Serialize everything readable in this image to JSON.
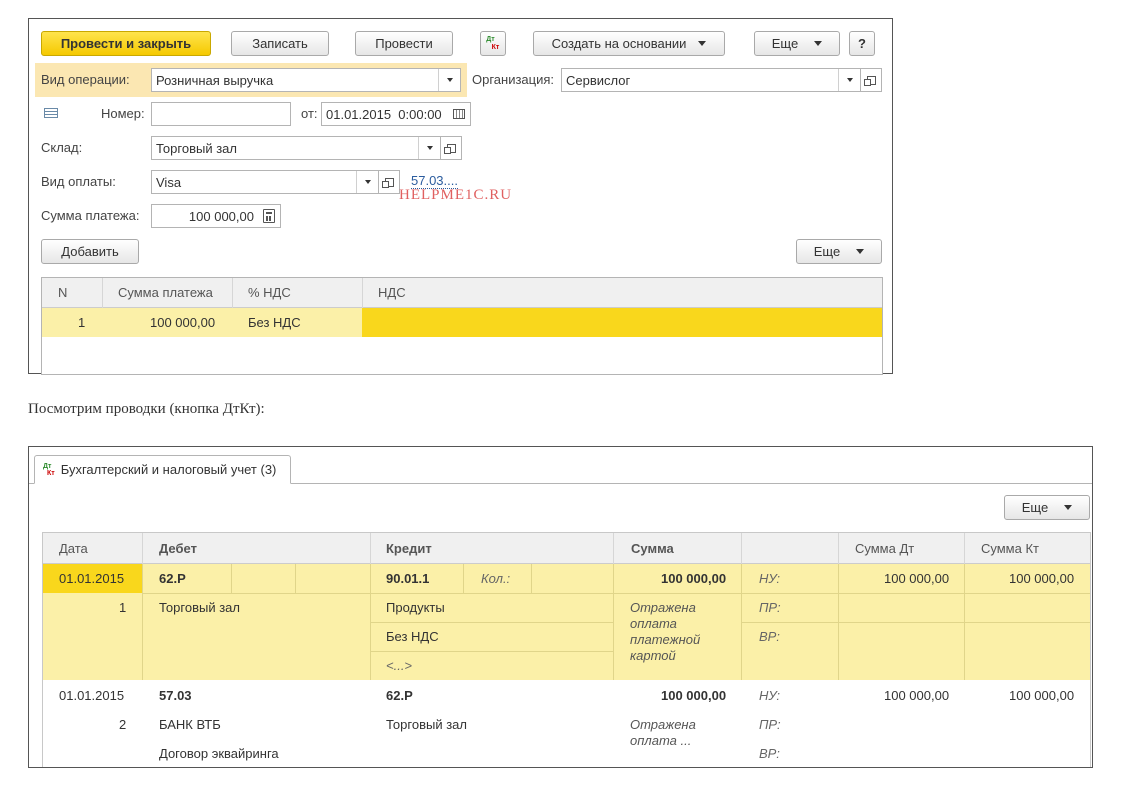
{
  "doc": {
    "toolbar": {
      "post_close": "Провести и закрыть",
      "save": "Записать",
      "post": "Провести",
      "dtkt_top": "Дт",
      "dtkt_bottom": "Кт",
      "create_basis": "Создать на основании",
      "more": "Еще",
      "help": "?"
    },
    "op_type": {
      "label": "Вид операции:",
      "value": "Розничная выручка"
    },
    "org": {
      "label": "Организация:",
      "value": "Сервислог"
    },
    "number": {
      "label": "Номер:",
      "value": ""
    },
    "date": {
      "label": "от:",
      "value": "01.01.2015  0:00:00"
    },
    "warehouse": {
      "label": "Склад:",
      "value": "Торговый зал"
    },
    "payment_type": {
      "label": "Вид оплаты:",
      "value": "Visa",
      "account_link": "57.03...."
    },
    "watermark": "HELPME1C.RU",
    "amount": {
      "label": "Сумма платежа:",
      "value": "100 000,00"
    },
    "add_button": "Добавить",
    "more2": "Еще",
    "table": {
      "headers": [
        "N",
        "Сумма платежа",
        "% НДС",
        "НДС"
      ],
      "rows": [
        {
          "n": "1",
          "sum": "100 000,00",
          "vat_rate": "Без НДС",
          "vat": ""
        }
      ]
    }
  },
  "caption": "Посмотрим проводки (кнопка ДтКт):",
  "postings": {
    "tab_label": "Бухгалтерский и налоговый учет (3)",
    "more": "Еще",
    "headers": {
      "date": "Дата",
      "debit": "Дебет",
      "credit": "Кредит",
      "sum": "Сумма",
      "blank": "",
      "sum_dt": "Сумма Дт",
      "sum_kt": "Сумма Кт"
    },
    "entries": [
      {
        "date": "01.01.2015",
        "n": "1",
        "debit": "62.Р",
        "debit_sub": [
          "Торговый зал"
        ],
        "credit": "90.01.1",
        "credit_qty": "Кол.:",
        "credit_sub": [
          "Продукты",
          "Без НДС",
          "<...>"
        ],
        "sum": "100 000,00",
        "content": "Отражена оплата платежной картой",
        "nu": "НУ:",
        "pr": "ПР:",
        "vr": "ВР:",
        "sum_dt": "100 000,00",
        "sum_kt": "100 000,00"
      },
      {
        "date": "01.01.2015",
        "n": "2",
        "debit": "57.03",
        "debit_sub": [
          "БАНК ВТБ",
          "Договор эквайринга"
        ],
        "credit": "62.Р",
        "credit_sub": [
          "Торговый зал"
        ],
        "sum": "100 000,00",
        "content": "Отражена оплата ...",
        "nu": "НУ:",
        "pr": "ПР:",
        "vr": "ВР:",
        "sum_dt": "100 000,00",
        "sum_kt": "100 000,00"
      }
    ]
  }
}
